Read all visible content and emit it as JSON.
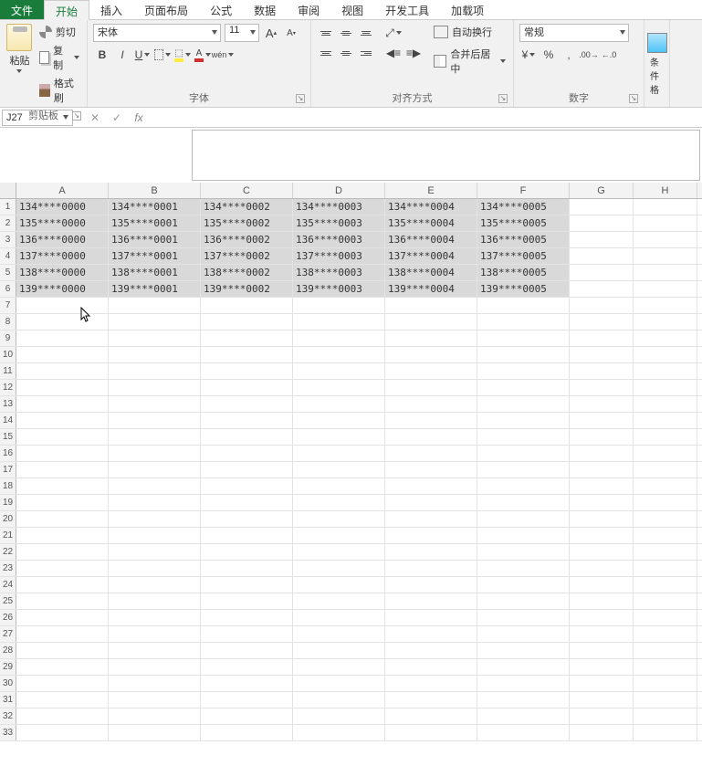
{
  "tabs": {
    "file": "文件",
    "items": [
      "开始",
      "插入",
      "页面布局",
      "公式",
      "数据",
      "审阅",
      "视图",
      "开发工具",
      "加载项"
    ],
    "active": "开始"
  },
  "ribbon": {
    "clipboard": {
      "label": "剪贴板",
      "paste": "粘贴",
      "cut": "剪切",
      "copy": "复制",
      "format_painter": "格式刷"
    },
    "font": {
      "label": "字体",
      "font_name": "宋体",
      "font_size": "11",
      "inc": "A",
      "dec": "A",
      "bold": "B",
      "italic": "I",
      "underline": "U",
      "phonetic": "wén"
    },
    "alignment": {
      "label": "对齐方式",
      "wrap": "自动换行",
      "merge": "合并后居中"
    },
    "number": {
      "label": "数字",
      "category": "常规",
      "percent": "%",
      "comma": ","
    },
    "styles": {
      "label": "条件格"
    }
  },
  "namebox": "J27",
  "columns": [
    "A",
    "B",
    "C",
    "D",
    "E",
    "F",
    "G",
    "H"
  ],
  "col_classes": [
    "wA",
    "wB",
    "wC",
    "wD",
    "wE",
    "wF",
    "wG",
    "wH"
  ],
  "data_rows": [
    [
      "134****0000",
      "134****0001",
      "134****0002",
      "134****0003",
      "134****0004",
      "134****0005",
      "",
      ""
    ],
    [
      "135****0000",
      "135****0001",
      "135****0002",
      "135****0003",
      "135****0004",
      "135****0005",
      "",
      ""
    ],
    [
      "136****0000",
      "136****0001",
      "136****0002",
      "136****0003",
      "136****0004",
      "136****0005",
      "",
      ""
    ],
    [
      "137****0000",
      "137****0001",
      "137****0002",
      "137****0003",
      "137****0004",
      "137****0005",
      "",
      ""
    ],
    [
      "138****0000",
      "138****0001",
      "138****0002",
      "138****0003",
      "138****0004",
      "138****0005",
      "",
      ""
    ],
    [
      "139****0000",
      "139****0001",
      "139****0002",
      "139****0003",
      "139****0004",
      "139****0005",
      "",
      ""
    ]
  ],
  "total_rows": 33,
  "selected_range": {
    "r1": 1,
    "c1": 0,
    "r2": 6,
    "c2": 5
  }
}
